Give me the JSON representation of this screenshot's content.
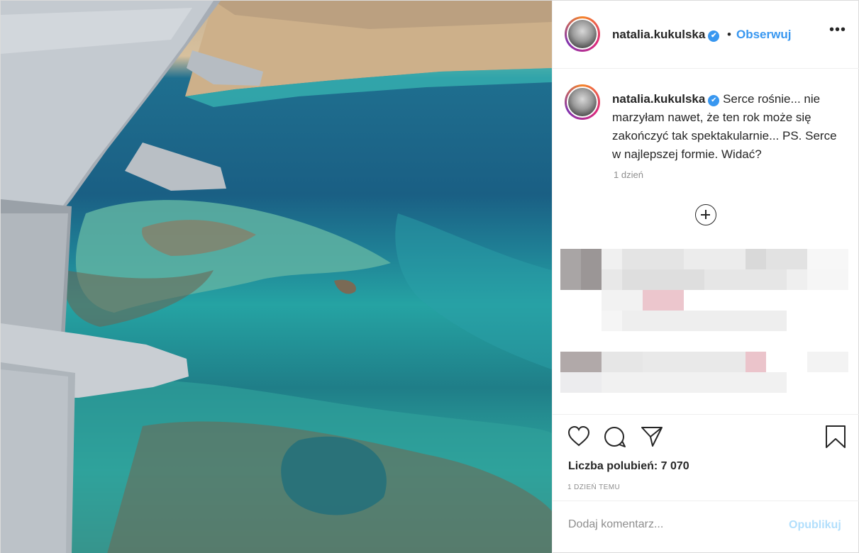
{
  "header": {
    "username": "natalia.kukulska",
    "separator": "•",
    "follow_label": "Obserwuj",
    "more_label": "•••"
  },
  "caption": {
    "username": "natalia.kukulska",
    "text": "Serce rośnie... nie marzyłam nawet, że ten rok może się zakończyć tak spektakularnie... PS. Serce w najlepszej formie. Widać?",
    "time": "1 dzień"
  },
  "actions": {
    "likes": "Liczba polubień: 7 070",
    "date": "1 DZIEŃ TEMU"
  },
  "comment": {
    "placeholder": "Dodaj komentarz...",
    "publish_label": "Opublikuj"
  },
  "colors": {
    "link": "#3897f0",
    "publish_disabled": "#b2dffc",
    "verified": "#3897f0"
  },
  "icons": [
    "verified-badge-icon",
    "more-options-icon",
    "load-more-comments-icon",
    "heart-icon",
    "comment-icon",
    "share-icon",
    "bookmark-icon"
  ]
}
